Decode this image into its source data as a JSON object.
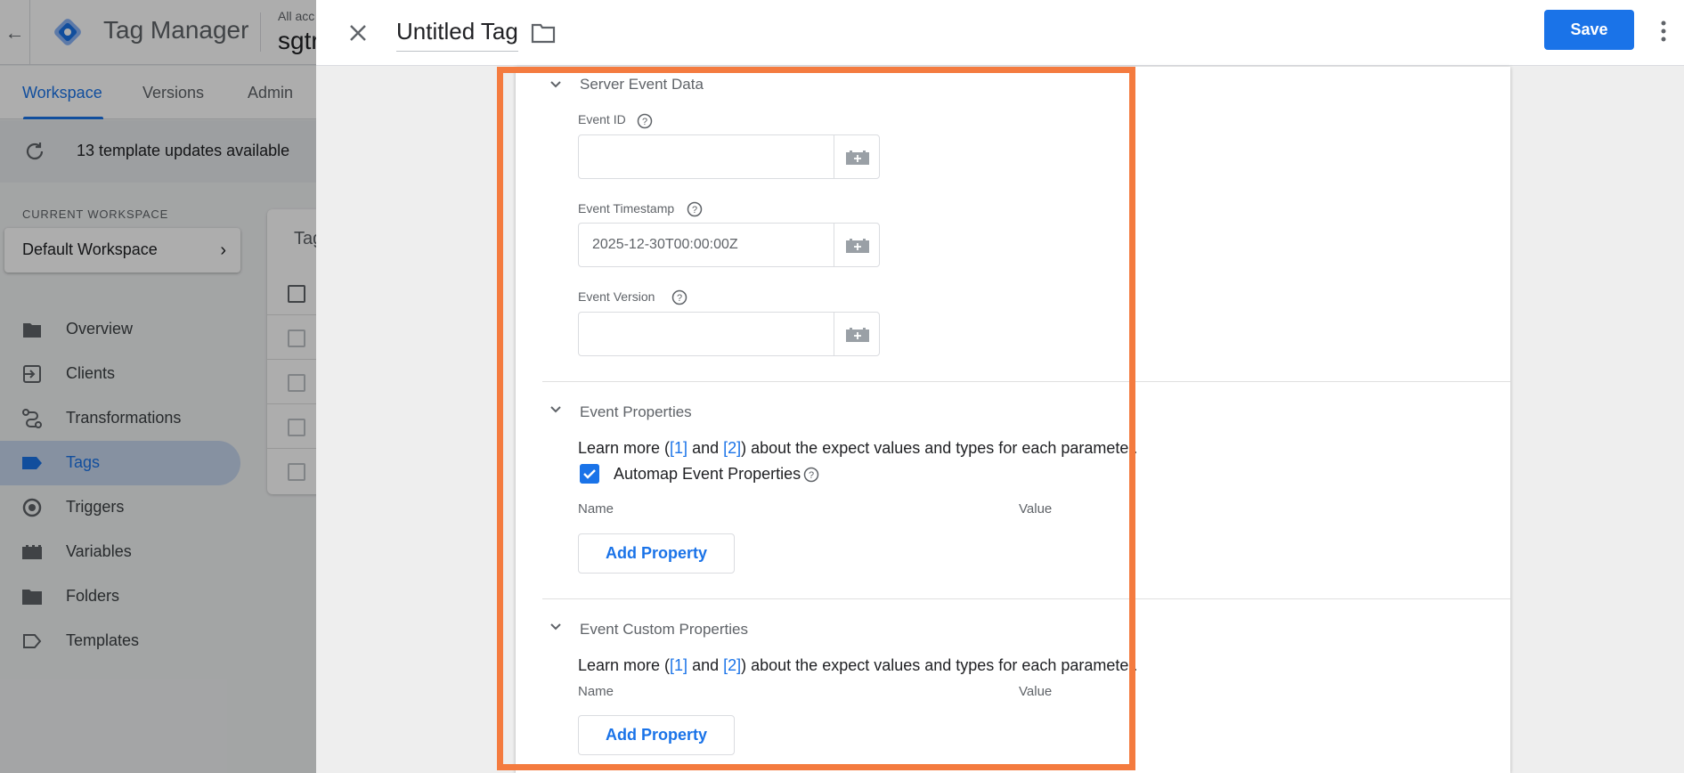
{
  "app": {
    "title": "Tag Manager",
    "account_small": "All acc",
    "account_large": "sgtr",
    "tabs": [
      {
        "label": "Workspace",
        "active": true
      },
      {
        "label": "Versions",
        "active": false
      },
      {
        "label": "Admin",
        "active": false
      }
    ],
    "updates_text": "13 template updates available",
    "current_workspace_label": "CURRENT WORKSPACE",
    "workspace_name": "Default Workspace",
    "nav": [
      {
        "label": "Overview",
        "icon": "overview-icon"
      },
      {
        "label": "Clients",
        "icon": "clients-icon"
      },
      {
        "label": "Transformations",
        "icon": "transformations-icon"
      },
      {
        "label": "Tags",
        "icon": "tags-icon",
        "active": true
      },
      {
        "label": "Triggers",
        "icon": "triggers-icon"
      },
      {
        "label": "Variables",
        "icon": "variables-icon"
      },
      {
        "label": "Folders",
        "icon": "folders-icon"
      },
      {
        "label": "Templates",
        "icon": "templates-icon"
      }
    ],
    "bg_card_title": "Tag"
  },
  "panel": {
    "tag_name": "Untitled Tag",
    "save_label": "Save",
    "accent_color": "#1a73e8",
    "highlight_color": "#f47b3f"
  },
  "server_event_data": {
    "title": "Server Event Data",
    "fields": [
      {
        "label": "Event ID",
        "value": ""
      },
      {
        "label": "Event Timestamp",
        "value": "2025-12-30T00:00:00Z"
      },
      {
        "label": "Event Version",
        "value": ""
      }
    ]
  },
  "event_properties": {
    "title": "Event Properties",
    "learn_prefix": "Learn more (",
    "link1": "[1]",
    "learn_and": " and ",
    "link2": "[2]",
    "learn_suffix": ") about the expect values and types for each parameter.",
    "automap_label": "Automap Event Properties",
    "automap_checked": true,
    "col_name": "Name",
    "col_value": "Value",
    "add_label": "Add Property"
  },
  "event_custom_properties": {
    "title": "Event Custom Properties",
    "learn_prefix": "Learn more (",
    "link1": "[1]",
    "learn_and": " and ",
    "link2": "[2]",
    "learn_suffix": ") about the expect values and types for each parameter.",
    "col_name": "Name",
    "col_value": "Value",
    "add_label": "Add Property"
  }
}
